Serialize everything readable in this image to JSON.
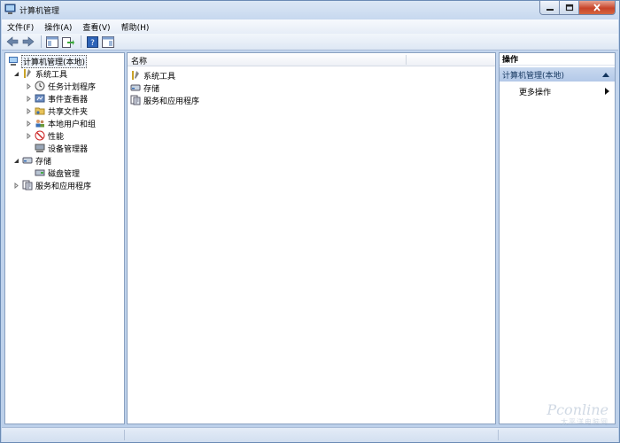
{
  "window": {
    "title": "计算机管理"
  },
  "menu": [
    "文件(F)",
    "操作(A)",
    "查看(V)",
    "帮助(H)"
  ],
  "tree": {
    "root": "计算机管理(本地)",
    "system_tools": "系统工具",
    "task_scheduler": "任务计划程序",
    "event_viewer": "事件查看器",
    "shared_folders": "共享文件夹",
    "local_users": "本地用户和组",
    "performance": "性能",
    "device_manager": "设备管理器",
    "storage": "存储",
    "disk_management": "磁盘管理",
    "services_apps": "服务和应用程序"
  },
  "list": {
    "column_name": "名称",
    "items": [
      "系统工具",
      "存储",
      "服务和应用程序"
    ]
  },
  "actions": {
    "header": "操作",
    "section": "计算机管理(本地)",
    "more": "更多操作"
  },
  "watermark": {
    "brand": "Pconline",
    "sub": "太平洋电脑网"
  },
  "colors": {
    "selection": "#b3c9e8",
    "border": "#8aa1c0",
    "close": "#c8442a"
  }
}
